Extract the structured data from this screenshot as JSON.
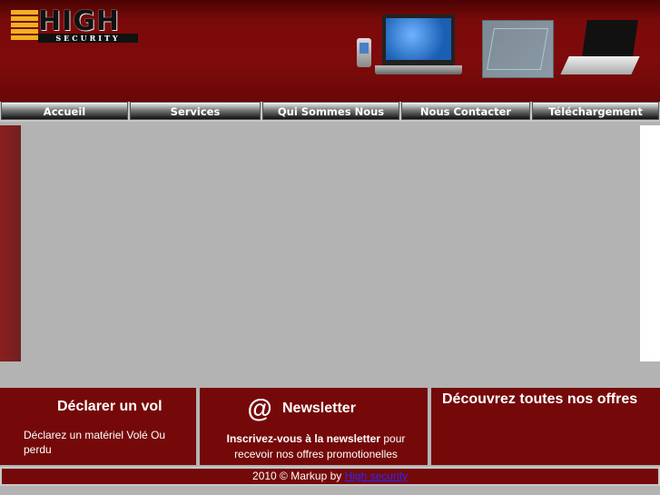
{
  "logo": {
    "word": "HIGH",
    "sub": "SECURITY"
  },
  "nav": {
    "items": [
      "Accueil",
      "Services",
      "Qui Sommes Nous",
      "Nous Contacter",
      "Téléchargement"
    ]
  },
  "boxes": {
    "declare": {
      "title": "Déclarer un vol",
      "text": "Déclarez un matériel Volé Ou perdu"
    },
    "newsletter": {
      "icon": "@",
      "title": "Newsletter",
      "text_bold": "Inscrivez-vous à la newsletter",
      "text_rest": " pour recevoir nos offres promotionelles"
    },
    "offers": {
      "title": "Découvrez toutes nos offres"
    }
  },
  "footer": {
    "text": "2010 © Markup by ",
    "link": "High security"
  },
  "colors": {
    "brand_red": "#750909",
    "header_red": "#7f0b0b",
    "logo_gold": "#f0b020",
    "link_blue": "#2a2aff"
  }
}
